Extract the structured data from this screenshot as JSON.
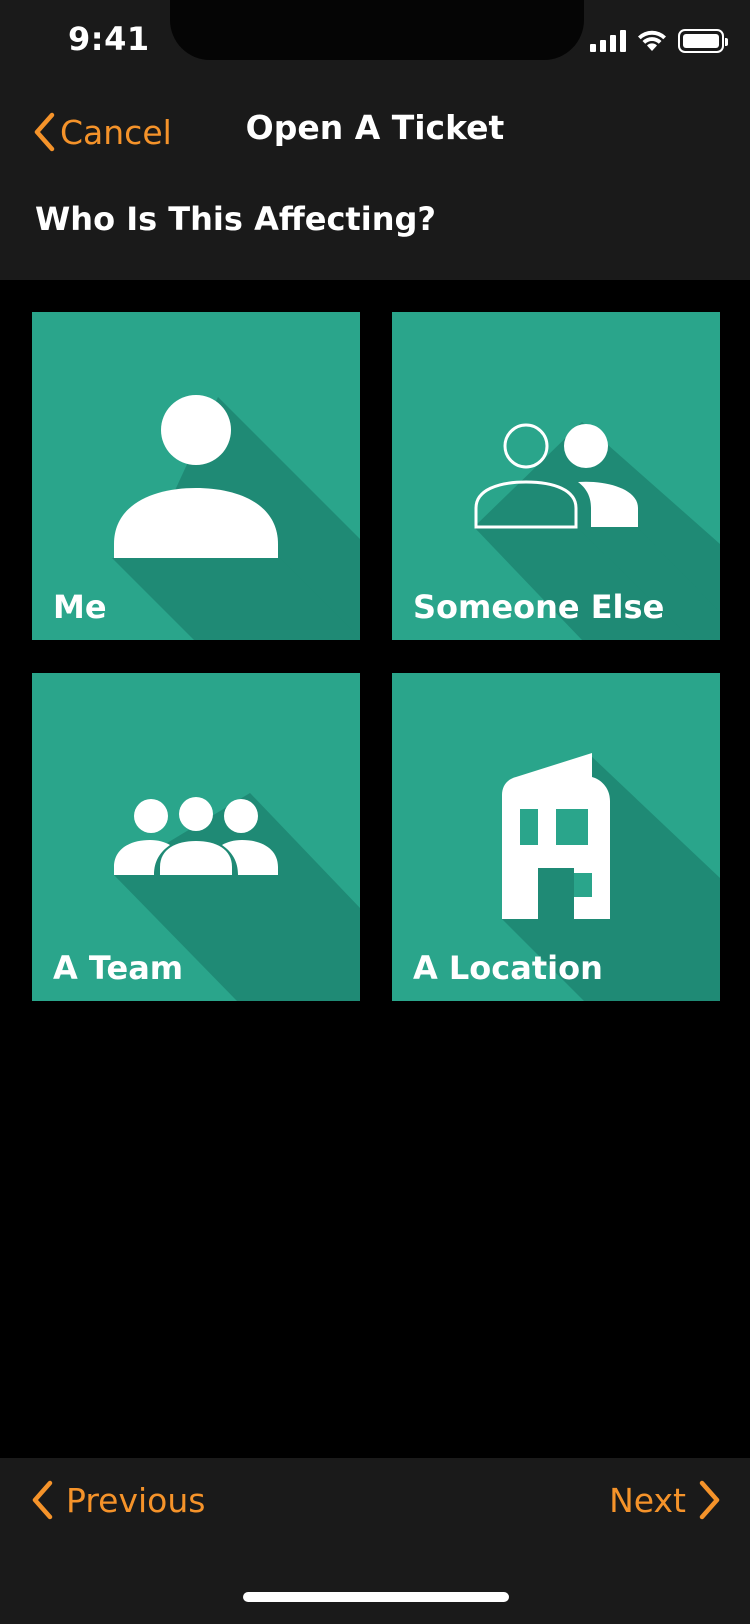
{
  "status_bar": {
    "time": "9:41",
    "signal_icon": "cellular-signal-icon",
    "wifi_icon": "wifi-icon",
    "battery_icon": "battery-icon"
  },
  "nav": {
    "cancel_label": "Cancel",
    "cancel_icon": "chevron-left-icon",
    "title": "Open A Ticket"
  },
  "question": "Who Is This Affecting?",
  "options": [
    {
      "label": "Me",
      "icon": "person-icon"
    },
    {
      "label": "Someone Else",
      "icon": "two-people-icon"
    },
    {
      "label": "A Team",
      "icon": "group-icon"
    },
    {
      "label": "A Location",
      "icon": "building-icon"
    }
  ],
  "footer": {
    "previous_label": "Previous",
    "next_label": "Next"
  },
  "colors": {
    "accent": "#f5932a",
    "tile": "#2aa58b",
    "tile_shadow": "#1f8a75",
    "bar_background": "#1a1a1a",
    "background": "#000000"
  }
}
